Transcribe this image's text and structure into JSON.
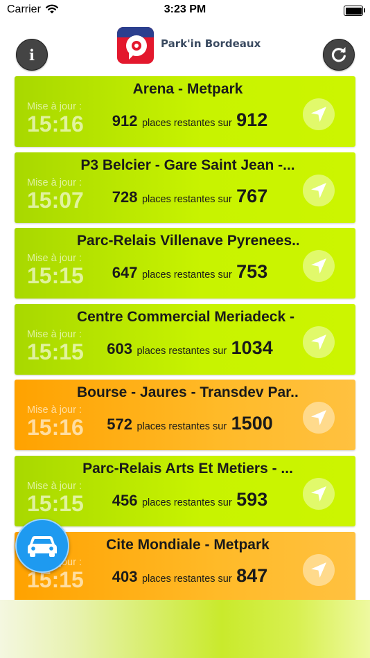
{
  "status_bar": {
    "carrier": "Carrier",
    "time": "3:23 PM",
    "battery_level": 1.0
  },
  "header": {
    "title": "Park'in Bordeaux",
    "info_label": "i"
  },
  "labels": {
    "updated": "Mise à jour :",
    "places_text": "places restantes sur"
  },
  "colors": {
    "green_card": "#c8f300",
    "orange_card": "#ffb020",
    "fab": "#1e9af0"
  },
  "parkings": [
    {
      "name": "Arena - Metpark",
      "time": "15:16",
      "available": "912",
      "total": "912",
      "status": "green"
    },
    {
      "name": "P3 Belcier - Gare Saint Jean -...",
      "time": "15:07",
      "available": "728",
      "total": "767",
      "status": "green"
    },
    {
      "name": "Parc-Relais Villenave Pyrenees...",
      "time": "15:15",
      "available": "647",
      "total": "753",
      "status": "green"
    },
    {
      "name": "Centre Commercial Meriadeck - ...",
      "time": "15:15",
      "available": "603",
      "total": "1034",
      "status": "green"
    },
    {
      "name": "Bourse - Jaures - Transdev Par...",
      "time": "15:16",
      "available": "572",
      "total": "1500",
      "status": "orange"
    },
    {
      "name": "Parc-Relais Arts Et Metiers - ...",
      "time": "15:15",
      "available": "456",
      "total": "593",
      "status": "green"
    },
    {
      "name": "Cite Mondiale - Metpark",
      "time": "15:15",
      "available": "403",
      "total": "847",
      "status": "orange"
    }
  ],
  "icons": {
    "info": "info-icon",
    "refresh": "refresh-icon",
    "navigate": "navigation-arrow-icon",
    "car": "car-icon",
    "logo": "parking-p-logo-icon",
    "wifi": "wifi-icon",
    "battery": "battery-icon"
  }
}
